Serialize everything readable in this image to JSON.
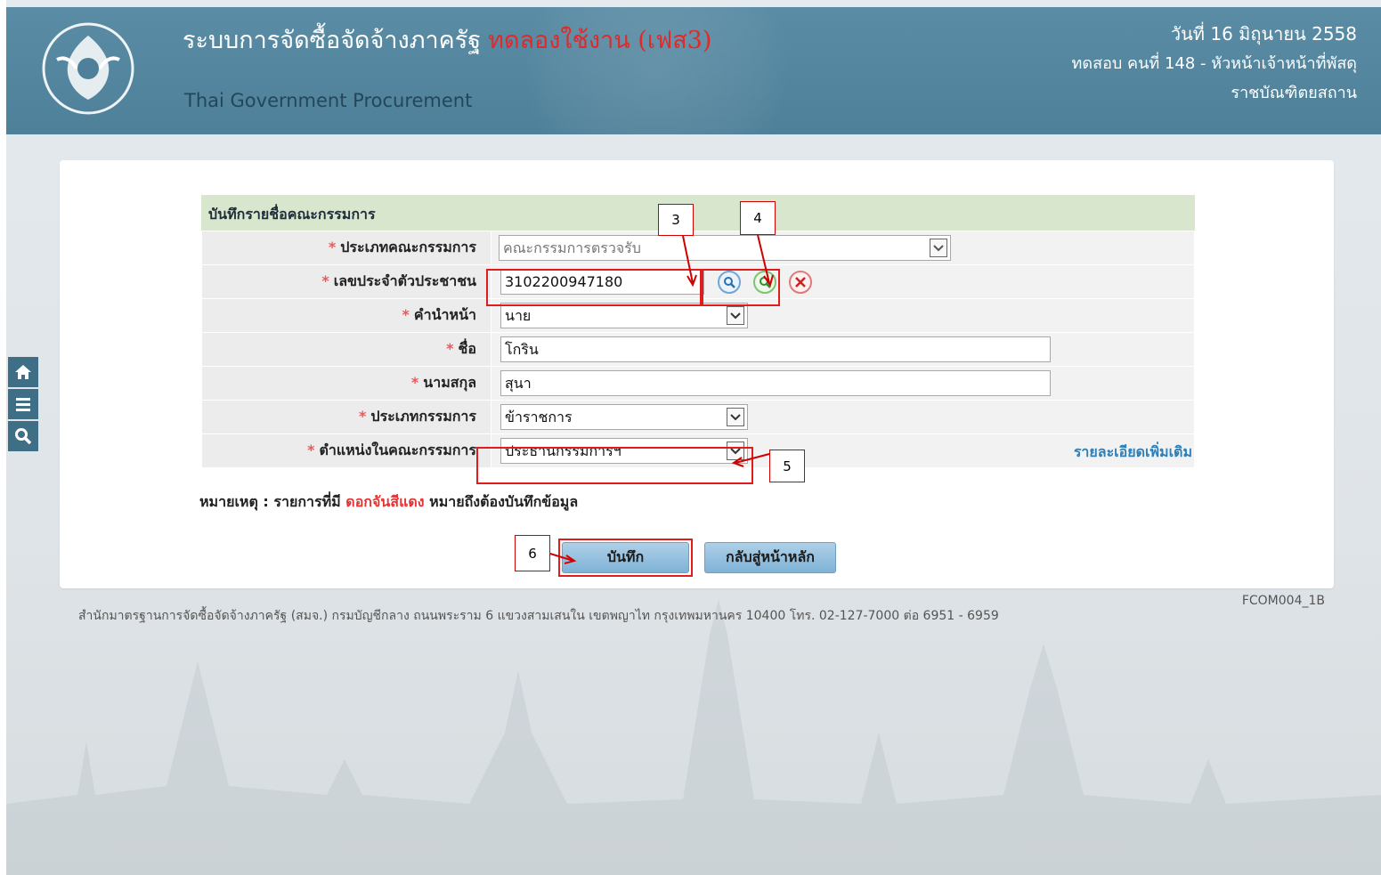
{
  "header": {
    "title": "ระบบการจัดซื้อจัดจ้างภาครัฐ",
    "test_badge": "ทดลองใช้งาน (เฟส3)",
    "subtitle": "Thai Government Procurement",
    "date": "วันที่ 16 มิถุนายน 2558",
    "user": "ทดสอบ คนที่ 148 - หัวหน้าเจ้าหน้าที่พัสดุ",
    "org": "ราชบัณฑิตยสถาน",
    "colors": {
      "header_bg": "#5a8ca5",
      "test_red": "#e02a2a"
    }
  },
  "side_nav": [
    {
      "icon": "home-icon"
    },
    {
      "icon": "menu-icon"
    },
    {
      "icon": "search-icon"
    }
  ],
  "form": {
    "title": "บันทึกรายชื่อคณะกรรมการ",
    "required_mark": "*",
    "fields": {
      "committee_type": {
        "label": "ประเภทคณะกรรมการ",
        "value": "คณะกรรมการตรวจรับ"
      },
      "citizen_id": {
        "label": "เลขประจำตัวประชาชน",
        "value": "3102200947180"
      },
      "prefix": {
        "label": "คำนำหน้า",
        "value": "นาย"
      },
      "first_name": {
        "label": "ชื่อ",
        "value": "โกริน"
      },
      "last_name": {
        "label": "นามสกุล",
        "value": "สุนา"
      },
      "member_type": {
        "label": "ประเภทกรรมการ",
        "value": "ข้าราชการ"
      },
      "position": {
        "label": "ตำแหน่งในคณะกรรมการ",
        "value": "ประธานกรรมการฯ"
      }
    },
    "more_link": "รายละเอียดเพิ่มเติม"
  },
  "note": {
    "prefix": "หมายเหตุ : รายการที่มี",
    "highlight": "ดอกจันสีแดง",
    "suffix": "หมายถึงต้องบันทึกข้อมูล"
  },
  "buttons": {
    "save": "บันทึก",
    "back": "กลับสู่หน้าหลัก"
  },
  "page_code": "FCOM004_1B",
  "footer": "สำนักมาตรฐานการจัดซื้อจัดจ้างภาครัฐ (สมจ.) กรมบัญชีกลาง ถนนพระราม 6 แขวงสามเสนใน เขตพญาไท กรุงเทพมหานคร 10400 โทร. 02-127-7000 ต่อ 6951 - 6959",
  "callouts": {
    "c3": "3",
    "c4": "4",
    "c5": "5",
    "c6": "6"
  }
}
